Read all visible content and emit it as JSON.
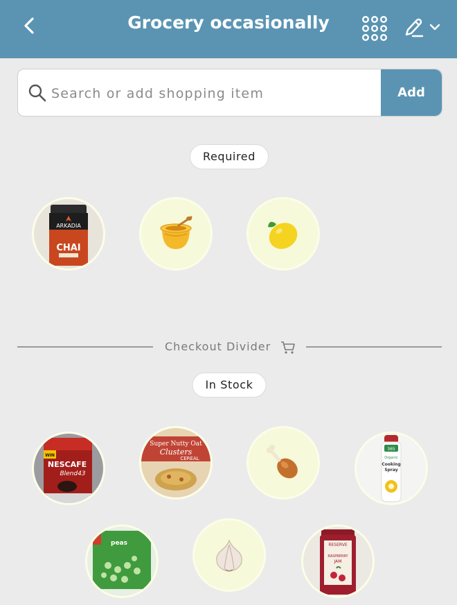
{
  "header": {
    "title": "Grocery occasionally",
    "back_icon": "chevron-left-icon",
    "grid_icon": "grid-dots-icon",
    "edit_icon": "pencil-edit-icon",
    "dropdown_icon": "chevron-down-icon",
    "background_color": "#5b94b3"
  },
  "search": {
    "placeholder": "Search or add shopping item",
    "value": "",
    "add_label": "Add"
  },
  "sections": {
    "required": {
      "label": "Required",
      "items": [
        {
          "name": "Arkadia Chai Latte Spice",
          "icon": "chai-tin-product-image",
          "label_1": "ARKADIA",
          "label_2": "CHAI"
        },
        {
          "name": "Honey",
          "icon": "honey-pot-icon"
        },
        {
          "name": "Lemon",
          "icon": "lemon-icon"
        }
      ]
    },
    "divider": {
      "label": "Checkout Divider",
      "icon": "cart-icon"
    },
    "in_stock": {
      "label": "In Stock",
      "items": [
        {
          "name": "Nescafe Blend 43",
          "icon": "coffee-jar-product-image",
          "label_1": "NESCAFE",
          "label_2": "Blend43",
          "label_3": "WIN"
        },
        {
          "name": "Super Nutty Oat Clusters Cereal",
          "icon": "cereal-box-product-image",
          "label_1": "Super Nutty Oat",
          "label_2": "Clusters",
          "label_3": "CEREAL"
        },
        {
          "name": "Chicken",
          "icon": "chicken-leg-icon"
        },
        {
          "name": "Organic Cooking Spray",
          "icon": "cooking-spray-product-image",
          "label_1": "365",
          "label_2": "Organic",
          "label_3": "Cooking",
          "label_4": "Spray"
        },
        {
          "name": "Peas",
          "icon": "frozen-peas-product-image",
          "label_1": "peas"
        },
        {
          "name": "Garlic",
          "icon": "garlic-icon"
        },
        {
          "name": "Raspberry Jam",
          "icon": "jam-jar-product-image",
          "label_1": "RESERVE",
          "label_2": "RASPBERRY",
          "label_3": "JAM"
        }
      ]
    }
  }
}
